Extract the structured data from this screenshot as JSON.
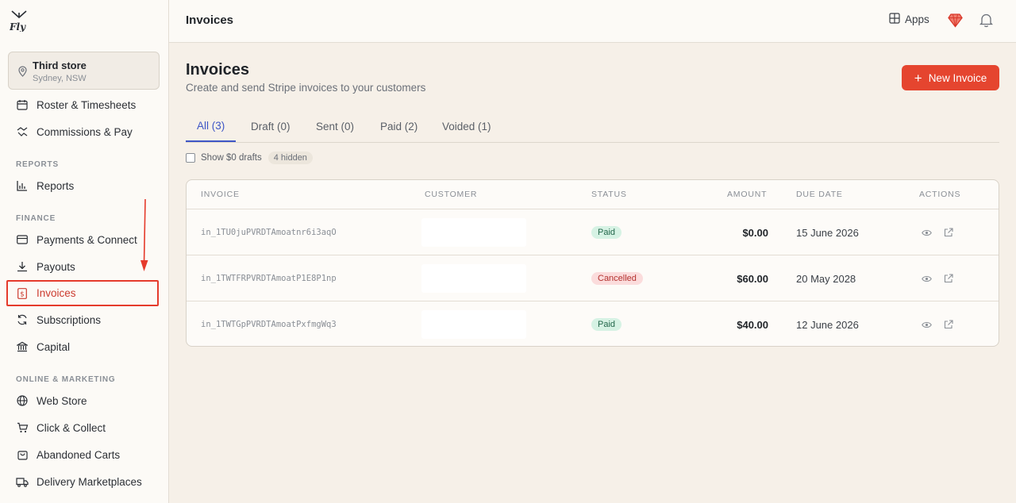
{
  "brand": {
    "logo_text": "Fly",
    "accent": "#e5452f"
  },
  "store": {
    "name": "Third store",
    "location": "Sydney, NSW"
  },
  "sidebar": {
    "items_top": [
      {
        "label": "Roster & Timesheets",
        "icon": "calendar-icon"
      },
      {
        "label": "Commissions & Pay",
        "icon": "handshake-icon"
      }
    ],
    "reports_label": "REPORTS",
    "reports": {
      "label": "Reports",
      "icon": "bar-chart-icon"
    },
    "finance_label": "FINANCE",
    "finance": [
      {
        "label": "Payments & Connect",
        "icon": "credit-card-icon"
      },
      {
        "label": "Payouts",
        "icon": "download-icon"
      },
      {
        "label": "Invoices",
        "icon": "dollar-doc-icon"
      },
      {
        "label": "Subscriptions",
        "icon": "refresh-icon"
      },
      {
        "label": "Capital",
        "icon": "bank-icon"
      }
    ],
    "online_label": "ONLINE & MARKETING",
    "online": [
      {
        "label": "Web Store",
        "icon": "globe-icon"
      },
      {
        "label": "Click & Collect",
        "icon": "cart-icon"
      },
      {
        "label": "Abandoned Carts",
        "icon": "bag-icon"
      },
      {
        "label": "Delivery Marketplaces",
        "icon": "truck-icon"
      }
    ]
  },
  "topbar": {
    "title": "Invoices",
    "apps_label": "Apps"
  },
  "page": {
    "title": "Invoices",
    "subtitle": "Create and send Stripe invoices to your customers",
    "new_button": "New Invoice"
  },
  "tabs": [
    "All (3)",
    "Draft (0)",
    "Sent (0)",
    "Paid (2)",
    "Voided (1)"
  ],
  "filters": {
    "show_drafts_label": "Show $0 drafts",
    "hidden_count": "4 hidden"
  },
  "table": {
    "headers": [
      "INVOICE",
      "CUSTOMER",
      "STATUS",
      "AMOUNT",
      "DUE DATE",
      "ACTIONS"
    ],
    "rows": [
      {
        "id": "in_1TU0juPVRDTAmoatnr6i3aqO",
        "status": "Paid",
        "amount": "$0.00",
        "due": "15 June 2026"
      },
      {
        "id": "in_1TWTFRPVRDTAmoatP1E8P1np",
        "status": "Cancelled",
        "amount": "$60.00",
        "due": "20 May 2028"
      },
      {
        "id": "in_1TWTGpPVRDTAmoatPxfmgWq3",
        "status": "Paid",
        "amount": "$40.00",
        "due": "12 June 2026"
      }
    ]
  }
}
